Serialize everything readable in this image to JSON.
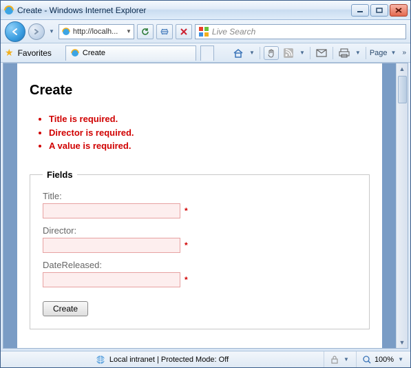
{
  "window": {
    "title": "Create - Windows Internet Explorer"
  },
  "nav": {
    "url": "http://localh...",
    "search_placeholder": "Live Search"
  },
  "favbar": {
    "favorites_label": "Favorites",
    "tab_label": "Create",
    "page_menu_label": "Page"
  },
  "page": {
    "heading": "Create",
    "errors": [
      "Title is required.",
      "Director is required.",
      "A value is required."
    ],
    "fieldset_legend": "Fields",
    "fields": {
      "title": {
        "label": "Title:",
        "value": ""
      },
      "director": {
        "label": "Director:",
        "value": ""
      },
      "date_released": {
        "label": "DateReleased:",
        "value": ""
      }
    },
    "submit_label": "Create"
  },
  "status": {
    "zone_text": "Local intranet | Protected Mode: Off",
    "zoom": "100%"
  }
}
